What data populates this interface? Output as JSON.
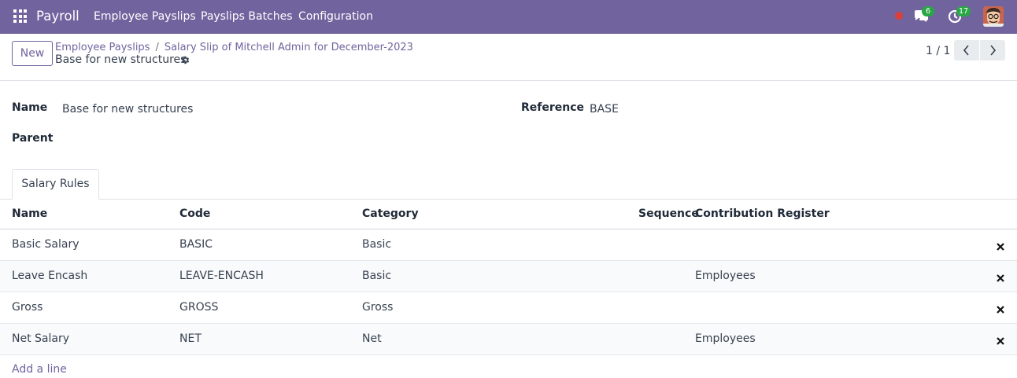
{
  "navbar": {
    "brand": "Payroll",
    "menu": [
      "Employee Payslips",
      "Payslips Batches",
      "Configuration"
    ],
    "messages_count": "6",
    "activities_count": "17",
    "accent_color": "#71639e",
    "status_color": "#d9403b",
    "badge_color": "#28a745"
  },
  "control_panel": {
    "new_label": "New",
    "breadcrumb": [
      "Employee Payslips",
      "Salary Slip of Mitchell Admin for December-2023"
    ],
    "breadcrumb_separator": "/",
    "record_title": "Base for new structures",
    "pager_value": "1 / 1"
  },
  "form": {
    "name_label": "Name",
    "name_value": "Base for new structures",
    "reference_label": "Reference",
    "reference_value": "BASE",
    "parent_label": "Parent",
    "parent_value": ""
  },
  "tabs": [
    "Salary Rules"
  ],
  "table": {
    "headers": [
      "Name",
      "Code",
      "Category",
      "Sequence",
      "Contribution Register"
    ],
    "rows": [
      [
        "Basic Salary",
        "BASIC",
        "Basic",
        "",
        ""
      ],
      [
        "Leave Encash",
        "LEAVE-ENCASH",
        "Basic",
        "",
        "Employees"
      ],
      [
        "Gross",
        "GROSS",
        "Gross",
        "",
        ""
      ],
      [
        "Net Salary",
        "NET",
        "Net",
        "",
        "Employees"
      ]
    ],
    "add_line_label": "Add a line"
  },
  "icons": [
    "apps-icon",
    "chat-icon",
    "clock-icon",
    "gear-icon",
    "chevron-left-icon",
    "chevron-right-icon",
    "close-icon"
  ]
}
